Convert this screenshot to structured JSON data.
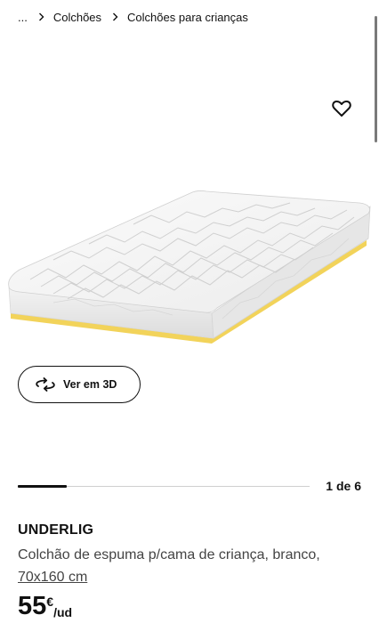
{
  "breadcrumb": {
    "ellipsis": "...",
    "items": [
      "Colchões",
      "Colchões para crianças"
    ]
  },
  "gallery": {
    "counter": "1 de 6",
    "position_fraction": 0.1667,
    "view_3d_label": "Ver em 3D"
  },
  "product": {
    "name": "UNDERLIG",
    "description": "Colchão de espuma p/cama de criança, branco,",
    "size": "70x160 cm"
  },
  "price": {
    "amount": "55",
    "currency": "€",
    "unit": "/ud"
  },
  "icons": [
    "chevron-right-icon",
    "heart-icon",
    "rotate-3d-icon"
  ],
  "colors": {
    "text": "#111111",
    "muted_text": "#444444",
    "mattress_base": "#f2d35a"
  }
}
